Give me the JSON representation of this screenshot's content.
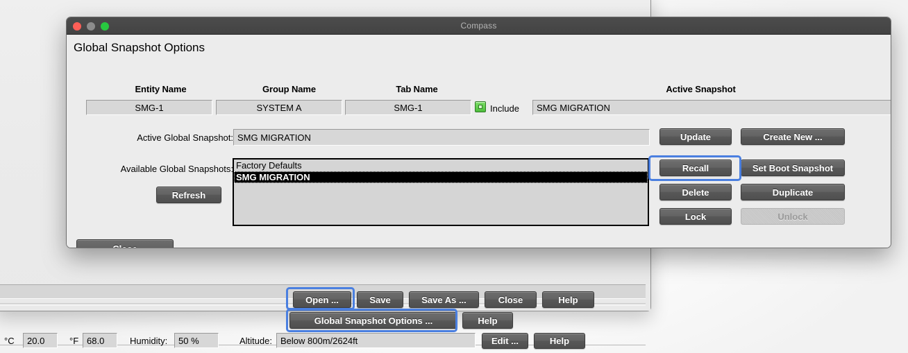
{
  "window": {
    "title": "Compass",
    "traffic_lights": [
      "close-light",
      "minimize-light",
      "zoom-light"
    ]
  },
  "dialog": {
    "heading": "Global Snapshot Options",
    "columns": [
      {
        "header": "Entity Name",
        "value": "SMG-1"
      },
      {
        "header": "Group Name",
        "value": "SYSTEM A"
      },
      {
        "header": "Tab Name",
        "value": "SMG-1"
      }
    ],
    "include": {
      "label": "Include",
      "checked": true
    },
    "active_snapshot": {
      "header": "Active Snapshot",
      "value": "SMG MIGRATION"
    },
    "active_global_snapshot": {
      "label": "Active Global Snapshot:",
      "value": "SMG MIGRATION"
    },
    "available_global_snapshots": {
      "label": "Available Global Snapshots:",
      "items": [
        "Factory Defaults",
        "SMG MIGRATION"
      ],
      "selected_index": 1
    },
    "refresh_label": "Refresh",
    "close_label": "Close",
    "action_buttons": [
      {
        "label": "Update",
        "disabled": false,
        "highlighted": false
      },
      {
        "label": "Create New ...",
        "disabled": false,
        "highlighted": false
      },
      {
        "label": "Recall",
        "disabled": false,
        "highlighted": true
      },
      {
        "label": "Set Boot Snapshot",
        "disabled": false,
        "highlighted": false
      },
      {
        "label": "Delete",
        "disabled": false,
        "highlighted": false
      },
      {
        "label": "Duplicate",
        "disabled": false,
        "highlighted": false
      },
      {
        "label": "Lock",
        "disabled": false,
        "highlighted": false
      },
      {
        "label": "Unlock",
        "disabled": true,
        "highlighted": false
      }
    ]
  },
  "background_window": {
    "toolbar_row1": [
      {
        "label": "Open ...",
        "highlighted": true
      },
      {
        "label": "Save",
        "highlighted": false
      },
      {
        "label": "Save As ...",
        "highlighted": false
      },
      {
        "label": "Close",
        "highlighted": false
      },
      {
        "label": "Help",
        "highlighted": false
      }
    ],
    "toolbar_row2": [
      {
        "label": "Global Snapshot Options ...",
        "highlighted": true
      },
      {
        "label": "Help",
        "highlighted": false
      }
    ],
    "status_row": {
      "celsius_label": "°C",
      "celsius_value": "20.0",
      "fahrenheit_label": "°F",
      "fahrenheit_value": "68.0",
      "humidity_label": "Humidity:",
      "humidity_value": "50 %",
      "altitude_label": "Altitude:",
      "altitude_value": "Below 800m/2624ft",
      "edit_label": "Edit ...",
      "help_label": "Help"
    },
    "colon_fragment": ":"
  },
  "colors": {
    "highlight": "#4a7fe0",
    "button_face": "#5e5e5e",
    "field_face": "#d7d7d7",
    "dialog_face": "#ececec",
    "titlebar": "#464646",
    "include_green": "#4dbd3b"
  }
}
